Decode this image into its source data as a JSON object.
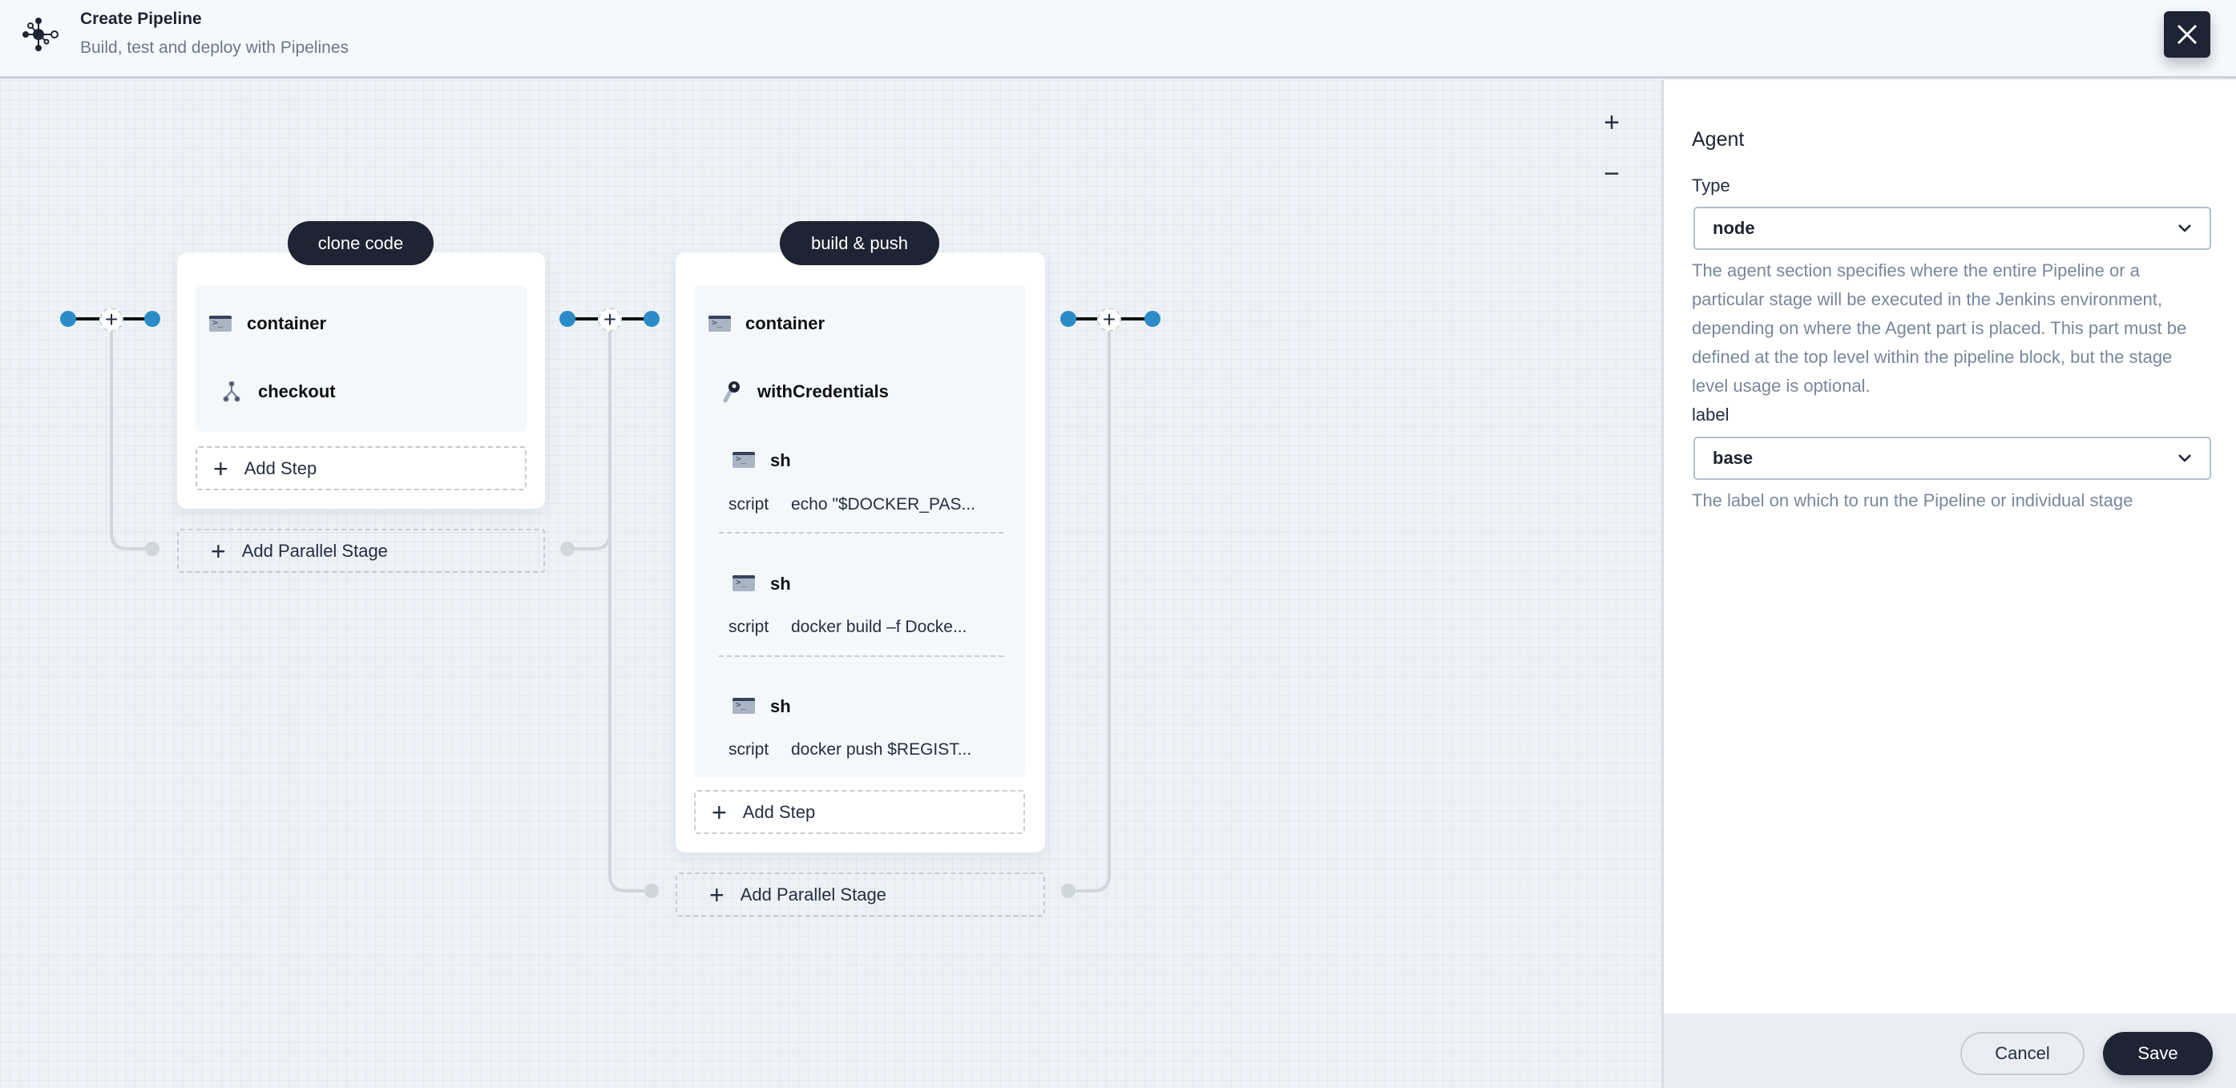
{
  "header": {
    "title": "Create Pipeline",
    "subtitle": "Build, test and deploy with Pipelines",
    "logo_icon": "pipeline-icon",
    "close_icon": "close-icon"
  },
  "canvas": {
    "zoom_in": "+",
    "zoom_out": "−",
    "stages": [
      {
        "name": "clone code",
        "steps": [
          {
            "icon": "terminal-icon",
            "name": "container"
          },
          {
            "icon": "git-branch-icon",
            "name": "checkout"
          }
        ],
        "add_step": "Add Step",
        "add_parallel": "Add Parallel Stage"
      },
      {
        "name": "build & push",
        "steps": [
          {
            "icon": "terminal-icon",
            "name": "container"
          },
          {
            "icon": "key-icon",
            "name": "withCredentials"
          },
          {
            "icon": "terminal-icon",
            "name": "sh",
            "param": "script",
            "value": "echo \"$DOCKER_PAS..."
          },
          {
            "icon": "terminal-icon",
            "name": "sh",
            "param": "script",
            "value": "docker build –f Docke..."
          },
          {
            "icon": "terminal-icon",
            "name": "sh",
            "param": "script",
            "value": "docker push $REGIST..."
          }
        ],
        "add_step": "Add Step",
        "add_parallel": "Add Parallel Stage"
      }
    ]
  },
  "panel": {
    "heading": "Agent",
    "type_label": "Type",
    "type_value": "node",
    "type_desc": "The agent section specifies where the entire Pipeline or a particular stage will be executed in the Jenkins environment, depending on where the Agent part is placed. This part must be defined at the top level within the pipeline block, but the stage level usage is optional.",
    "label_label": "label",
    "label_value": "base",
    "label_desc": "The label on which to run the Pipeline or individual stage"
  },
  "footer": {
    "cancel": "Cancel",
    "save": "Save"
  },
  "colors": {
    "dark": "#1e2433",
    "node_blue": "#2a8bc8",
    "connector_gray": "#d0d6de"
  }
}
